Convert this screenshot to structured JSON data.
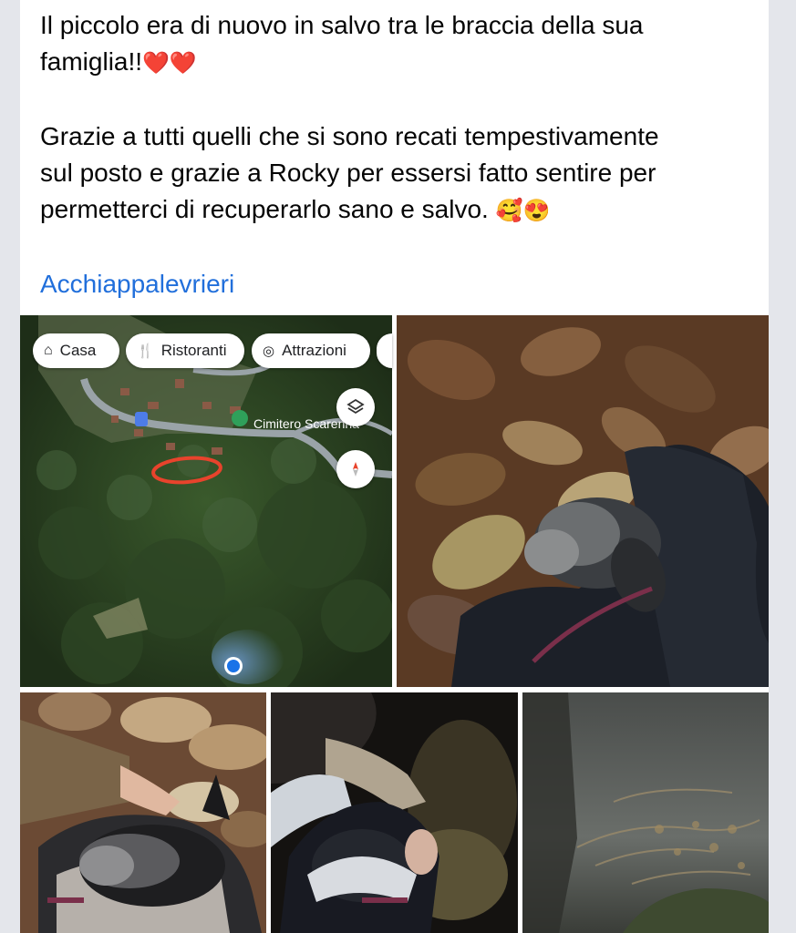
{
  "post": {
    "line1": "Il piccolo era di nuovo in salvo tra le braccia della sua",
    "line2": "famiglia!!",
    "line2_emoji": "❤️❤️",
    "line3": "Grazie a tutti quelli che si sono recati tempestivamente",
    "line4": "sul posto e grazie a Rocky per essersi fatto sentire per",
    "line5": "permetterci di recuperarlo sano e salvo.",
    "line5_emoji": "🥰😍",
    "hashtag": "Acchiappalevrieri"
  },
  "map": {
    "chips": [
      {
        "icon": "home-icon",
        "label": "Casa"
      },
      {
        "icon": "restaurant-icon",
        "label": "Ristoranti"
      },
      {
        "icon": "attractions-icon",
        "label": "Attrazioni"
      }
    ],
    "place_label": "Cimitero Scarenna",
    "colors": {
      "route": "#e8432c",
      "location": "#1a73e8"
    }
  },
  "photos": [
    {
      "name": "dog-in-jacket-on-leaves"
    },
    {
      "name": "dog-held-in-bag"
    },
    {
      "name": "rescuer-with-dog-night"
    },
    {
      "name": "dark-forest-night"
    }
  ]
}
